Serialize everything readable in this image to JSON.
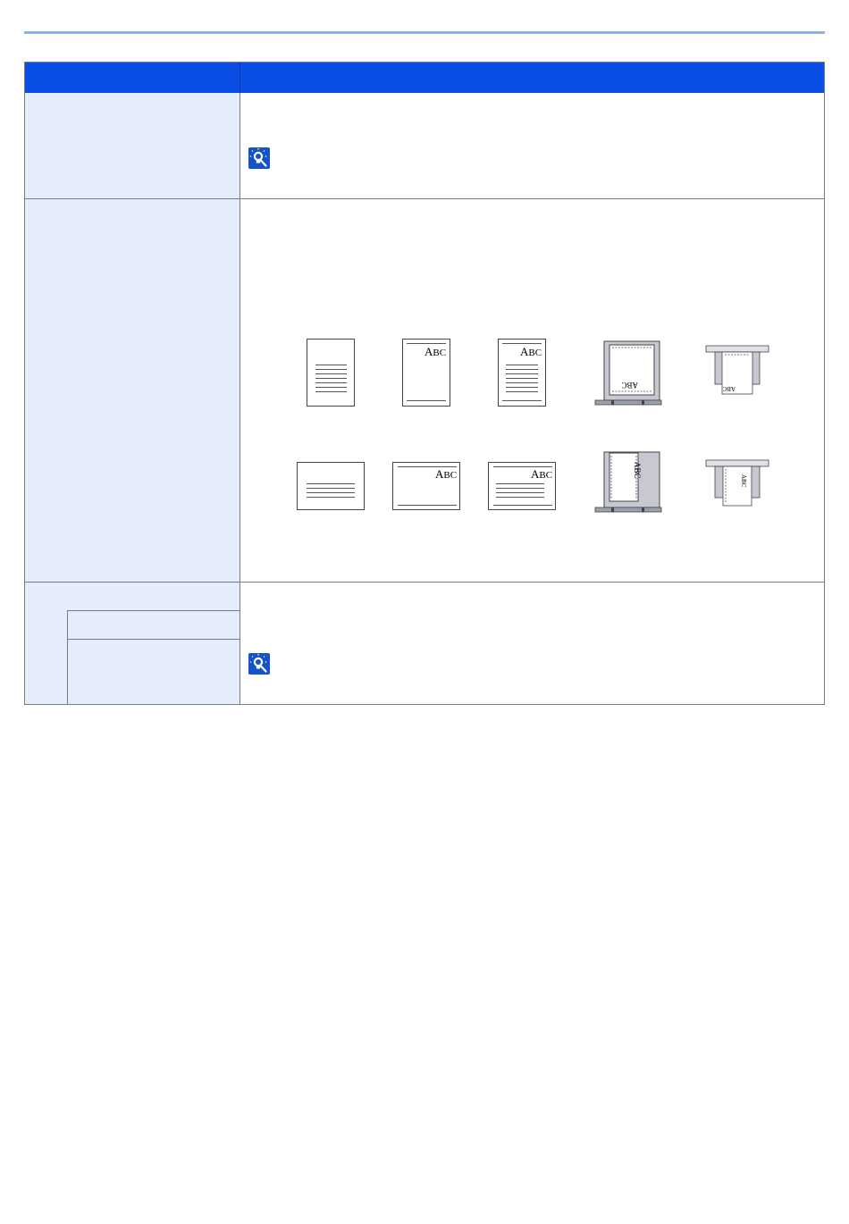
{
  "colors": {
    "header": "#0a4ee6",
    "left_col": "#e5ecfb",
    "rule": "#8fb0ee",
    "hint_icon": "#1553c7"
  },
  "header": {
    "col1": "",
    "col2": ""
  },
  "rows": [
    {
      "name": "row-1",
      "label": "",
      "hint_icon": "hint-lightbulb-icon"
    },
    {
      "name": "row-2",
      "label": ""
    },
    {
      "name": "row-3",
      "label": "",
      "sub_labels": [
        "",
        ""
      ],
      "hint_icon": "hint-lightbulb-icon"
    }
  ],
  "illustrations": {
    "abc_text": "ABC",
    "abc_cap": "A",
    "abc_rest": "BC",
    "portrait": [
      "portrait-plain-document",
      "portrait-abc-blank",
      "portrait-abc-text",
      "portrait-platen-placement",
      "portrait-feeder-placement"
    ],
    "landscape": [
      "landscape-plain-document",
      "landscape-abc-blank",
      "landscape-abc-text",
      "landscape-platen-placement",
      "landscape-feeder-placement"
    ]
  }
}
